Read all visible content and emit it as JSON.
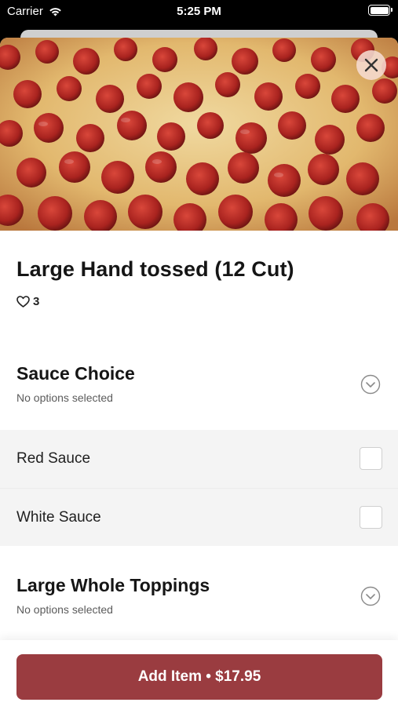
{
  "status_bar": {
    "carrier": "Carrier",
    "time": "5:25 PM",
    "icons": [
      "wifi-icon",
      "battery-icon"
    ]
  },
  "item": {
    "title": "Large Hand tossed (12 Cut)",
    "like_count": "3",
    "image": "pepperoni-pizza-photo"
  },
  "groups": [
    {
      "title": "Sauce Choice",
      "status": "No options selected",
      "options": [
        {
          "label": "Red Sauce",
          "checked": false
        },
        {
          "label": "White Sauce",
          "checked": false
        }
      ]
    },
    {
      "title": "Large Whole Toppings",
      "status": "No options selected"
    }
  ],
  "footer": {
    "add_button_label": "Add Item • $17.95"
  },
  "colors": {
    "accent": "#9a3c40",
    "options_background": "#f4f4f4",
    "close_button": "#f6dcd2"
  }
}
